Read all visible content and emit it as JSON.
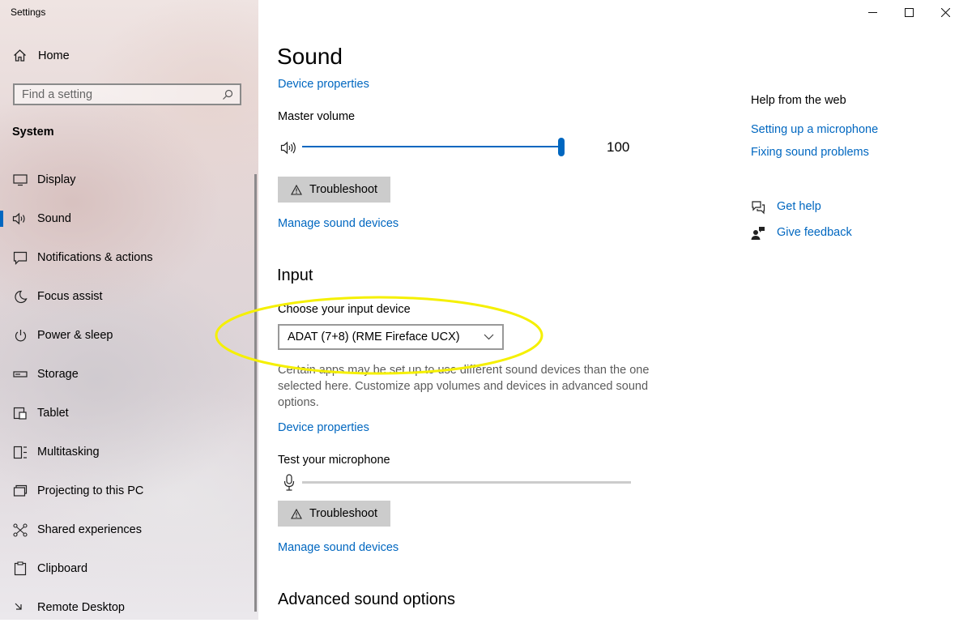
{
  "window": {
    "title": "Settings"
  },
  "sidebar": {
    "home": "Home",
    "search_placeholder": "Find a setting",
    "section": "System",
    "items": [
      {
        "label": "Display",
        "icon": "monitor-icon"
      },
      {
        "label": "Sound",
        "icon": "speaker-icon",
        "active": true
      },
      {
        "label": "Notifications & actions",
        "icon": "notification-icon"
      },
      {
        "label": "Focus assist",
        "icon": "moon-icon"
      },
      {
        "label": "Power & sleep",
        "icon": "power-icon"
      },
      {
        "label": "Storage",
        "icon": "storage-icon"
      },
      {
        "label": "Tablet",
        "icon": "tablet-icon"
      },
      {
        "label": "Multitasking",
        "icon": "multitasking-icon"
      },
      {
        "label": "Projecting to this PC",
        "icon": "projecting-icon"
      },
      {
        "label": "Shared experiences",
        "icon": "shared-icon"
      },
      {
        "label": "Clipboard",
        "icon": "clipboard-icon"
      },
      {
        "label": "Remote Desktop",
        "icon": "remote-desktop-icon"
      }
    ]
  },
  "main": {
    "title": "Sound",
    "output": {
      "device_properties": "Device properties",
      "master_volume_label": "Master volume",
      "volume_value": "100",
      "volume_level": 1.0,
      "troubleshoot": "Troubleshoot",
      "manage_devices": "Manage sound devices"
    },
    "input": {
      "heading": "Input",
      "choose_label": "Choose your input device",
      "selected_device": "ADAT (7+8) (RME Fireface UCX)",
      "description": "Certain apps may be set up to use different sound devices than the one selected here. Customize app volumes and devices in advanced sound options.",
      "device_properties": "Device properties",
      "test_mic_label": "Test your microphone",
      "mic_level": 0,
      "troubleshoot": "Troubleshoot",
      "manage_devices": "Manage sound devices"
    },
    "advanced_heading": "Advanced sound options"
  },
  "help": {
    "heading": "Help from the web",
    "links": [
      "Setting up a microphone",
      "Fixing sound problems"
    ],
    "get_help": "Get help",
    "give_feedback": "Give feedback"
  },
  "colors": {
    "accent": "#0067c0",
    "highlight_annotation": "#f5f000"
  }
}
